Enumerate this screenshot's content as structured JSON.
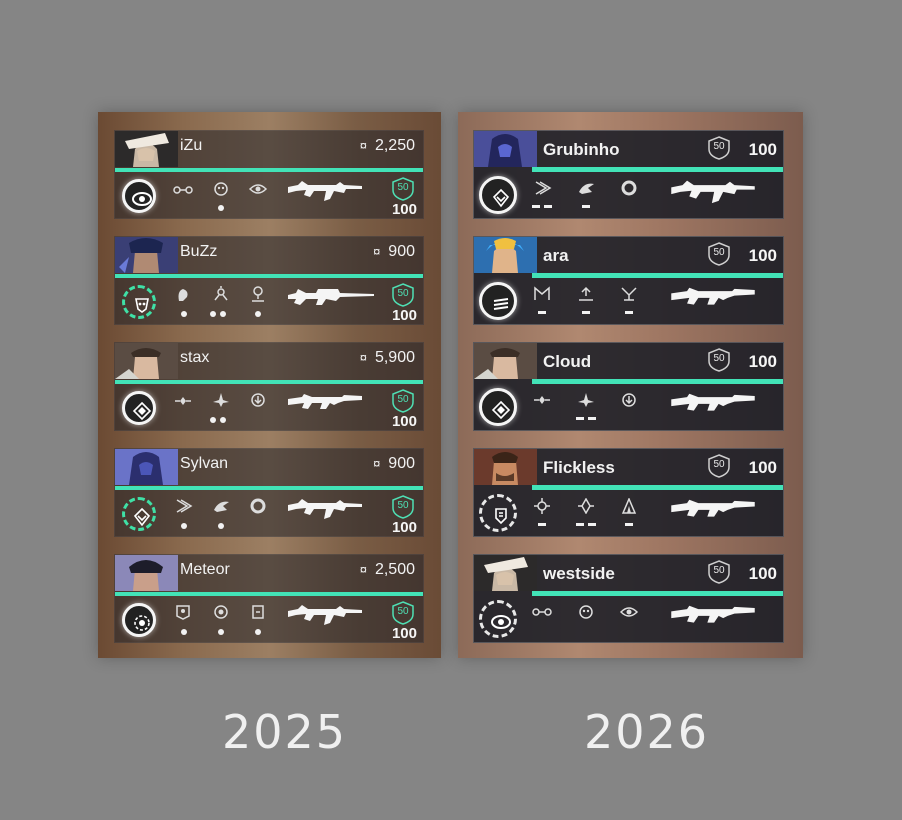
{
  "labels": {
    "left_year": "2025",
    "right_year": "2026"
  },
  "colors": {
    "accent": "#42e3b7",
    "background": "#858585",
    "card_new": "#171b24"
  },
  "hud_2025": {
    "players": [
      {
        "name": "iZu",
        "credits": "2,250",
        "shield": "50",
        "hp": "100",
        "weapon": "rifle-vandal-icon",
        "ult": "ready"
      },
      {
        "name": "BuZz",
        "credits": "900",
        "shield": "50",
        "hp": "100",
        "weapon": "sniper-operator-icon",
        "ult": "charging"
      },
      {
        "name": "stax",
        "credits": "5,900",
        "shield": "50",
        "hp": "100",
        "weapon": "rifle-phantom-icon",
        "ult": "ready"
      },
      {
        "name": "Sylvan",
        "credits": "900",
        "shield": "50",
        "hp": "100",
        "weapon": "rifle-vandal-icon",
        "ult": "charging"
      },
      {
        "name": "Meteor",
        "credits": "2,500",
        "shield": "50",
        "hp": "100",
        "weapon": "rifle-vandal-icon",
        "ult": "ready"
      }
    ]
  },
  "hud_2026": {
    "players": [
      {
        "name": "Grubinho",
        "shield": "50",
        "hp": "100",
        "weapon": "rifle-vandal-icon",
        "ult": "ready"
      },
      {
        "name": "ara",
        "shield": "50",
        "hp": "100",
        "weapon": "rifle-phantom-icon",
        "ult": "ready"
      },
      {
        "name": "Cloud",
        "shield": "50",
        "hp": "100",
        "weapon": "rifle-phantom-icon",
        "ult": "ready"
      },
      {
        "name": "Flickless",
        "shield": "50",
        "hp": "100",
        "weapon": "rifle-phantom-icon",
        "ult": "charging"
      },
      {
        "name": "westside",
        "shield": "50",
        "hp": "100",
        "weapon": "rifle-phantom-icon",
        "ult": "charging"
      }
    ]
  }
}
